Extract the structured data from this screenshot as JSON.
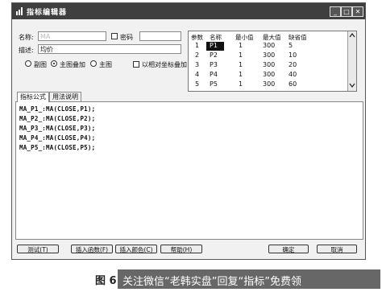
{
  "window": {
    "title": "指标编辑器",
    "controls": [
      "_",
      "□",
      "✕"
    ]
  },
  "form": {
    "name_label": "名称:",
    "name_value": "MA",
    "password_label": "密码",
    "desc_label": "描述:",
    "desc_value": "均价",
    "radio_options": [
      "副图",
      "主图叠加",
      "主图"
    ],
    "radio_selected": "主图叠加",
    "absolute_axis_label": "以相对坐标叠加"
  },
  "params": {
    "headers": [
      "参数",
      "名称",
      "最小值",
      "最大值",
      "缺省值"
    ],
    "rows": [
      [
        "1",
        "P1",
        "1",
        "300",
        "5"
      ],
      [
        "2",
        "P2",
        "1",
        "300",
        "10"
      ],
      [
        "3",
        "P3",
        "1",
        "300",
        "20"
      ],
      [
        "4",
        "P4",
        "1",
        "300",
        "40"
      ],
      [
        "5",
        "P5",
        "1",
        "300",
        "60"
      ]
    ]
  },
  "tabs": [
    "指标公式",
    "用法说明"
  ],
  "active_tab": "指标公式",
  "formula_lines": [
    "MA_P1_:MA(CLOSE,P1);",
    "MA_P2_:MA(CLOSE,P2);",
    "MA_P3_:MA(CLOSE,P3);",
    "MA_P4_:MA(CLOSE,P4);",
    "MA_P5_:MA(CLOSE,P5);"
  ],
  "buttons": {
    "test": "测试(T)",
    "insert_function": "插入函数(F)",
    "insert_color": "插入颜色(C)",
    "help": "帮助(H)",
    "ok": "确定",
    "cancel": "取消"
  },
  "caption": {
    "figure_prefix": "图 6",
    "watermark": "关注微信“老韩实盘”回复“指标”免费领"
  }
}
